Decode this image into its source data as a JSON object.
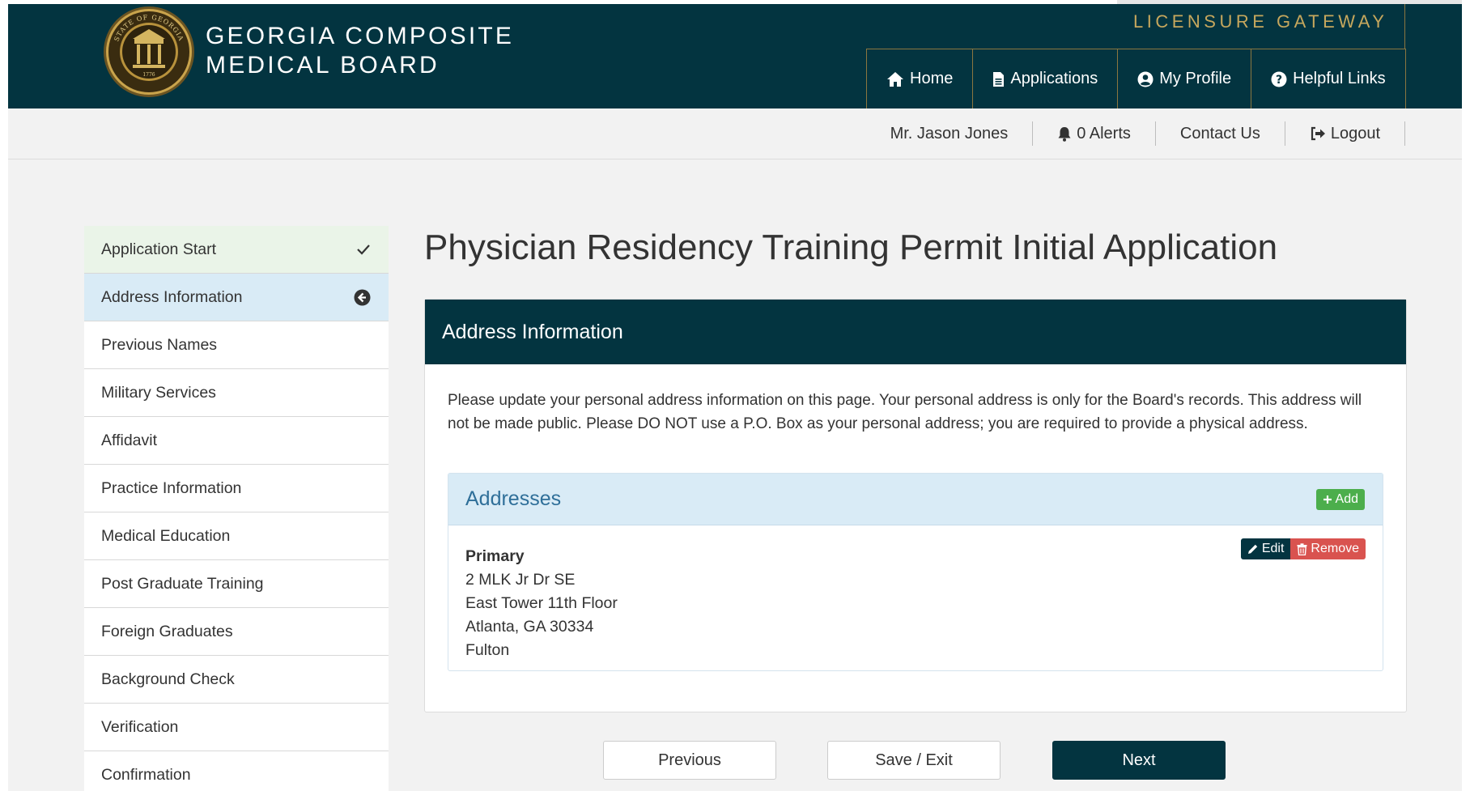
{
  "header": {
    "brand_line1": "GEORGIA COMPOSITE",
    "brand_line2": "MEDICAL BOARD",
    "gateway": "LICENSURE GATEWAY",
    "seal_text_top": "STATE OF GEORGIA",
    "seal_year": "1776",
    "nav": [
      {
        "label": "Home",
        "icon": "home-icon"
      },
      {
        "label": "Applications",
        "icon": "document-icon"
      },
      {
        "label": "My Profile",
        "icon": "user-circle-icon"
      },
      {
        "label": "Helpful Links",
        "icon": "question-circle-icon"
      }
    ]
  },
  "subbar": {
    "user": "Mr. Jason Jones",
    "alerts": "0 Alerts",
    "contact": "Contact Us",
    "logout": "Logout"
  },
  "sidebar": {
    "items": [
      {
        "label": "Application Start",
        "state": "done"
      },
      {
        "label": "Address Information",
        "state": "active"
      },
      {
        "label": "Previous Names",
        "state": ""
      },
      {
        "label": "Military Services",
        "state": ""
      },
      {
        "label": "Affidavit",
        "state": ""
      },
      {
        "label": "Practice Information",
        "state": ""
      },
      {
        "label": "Medical Education",
        "state": ""
      },
      {
        "label": "Post Graduate Training",
        "state": ""
      },
      {
        "label": "Foreign Graduates",
        "state": ""
      },
      {
        "label": "Background Check",
        "state": ""
      },
      {
        "label": "Verification",
        "state": ""
      },
      {
        "label": "Confirmation",
        "state": ""
      }
    ]
  },
  "main": {
    "title": "Physician Residency Training Permit Initial Application",
    "panel_title": "Address Information",
    "instructions": "Please update your personal address information on this page. Your personal address is only for the Board's records. This address will not be made public. Please DO NOT use a P.O. Box as your personal address; you are required to provide a physical address.",
    "addresses": {
      "title": "Addresses",
      "add_label": "Add",
      "edit_label": "Edit",
      "remove_label": "Remove",
      "entry": {
        "type": "Primary",
        "line1": "2 MLK Jr Dr SE",
        "line2": "East Tower 11th Floor",
        "city_state_zip": "Atlanta, GA 30334",
        "county": "Fulton"
      }
    }
  },
  "buttons": {
    "previous": "Previous",
    "save_exit": "Save / Exit",
    "next": "Next"
  },
  "colors": {
    "brand_dark": "#033440",
    "gold": "#c6a75d",
    "success": "#4cae4c",
    "danger": "#d9534f",
    "active_bg": "#d9ebf6",
    "done_bg": "#eaf4e8"
  }
}
